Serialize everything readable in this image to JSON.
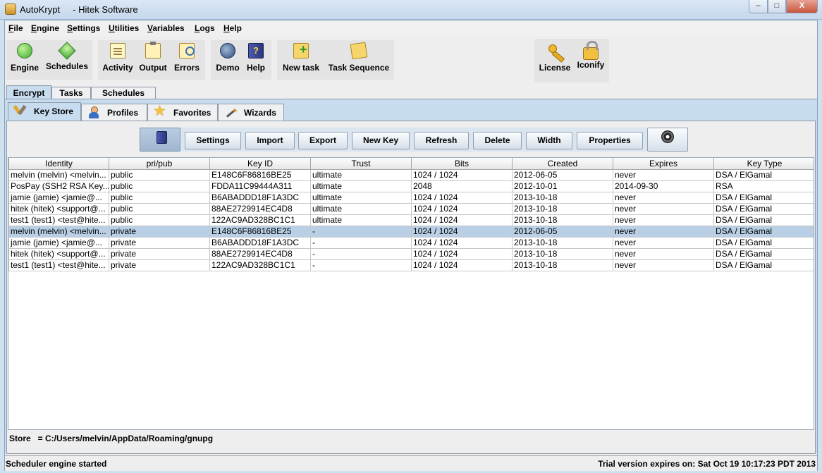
{
  "window": {
    "title": "AutoKrypt",
    "subtitle": "- Hitek Software",
    "minimize_label": "–",
    "maximize_label": "□",
    "close_label": "X"
  },
  "menu": [
    {
      "label": "File",
      "ul": "F",
      "rest": "ile"
    },
    {
      "label": "Engine",
      "ul": "E",
      "rest": "ngine"
    },
    {
      "label": "Settings",
      "ul": "S",
      "rest": "ettings"
    },
    {
      "label": "Utilities",
      "ul": "U",
      "rest": "tilities"
    },
    {
      "label": "Variables",
      "ul": "V",
      "rest": "ariables"
    },
    {
      "label": "Logs",
      "ul": "L",
      "rest": "ogs"
    },
    {
      "label": "Help",
      "ul": "H",
      "rest": "elp"
    }
  ],
  "toolbar": {
    "engine": "Engine",
    "schedules": "Schedules",
    "activity": "Activity",
    "output": "Output",
    "errors": "Errors",
    "demo": "Demo",
    "help": "Help",
    "new_task": "New task",
    "task_sequence": "Task Sequence",
    "license": "License",
    "iconify": "Iconify"
  },
  "main_tabs": [
    "Encrypt",
    "Tasks",
    "Schedules"
  ],
  "sub_tabs": [
    "Key Store",
    "Profiles",
    "Favorites",
    "Wizards"
  ],
  "actions": {
    "settings": "Settings",
    "import": "Import",
    "export": "Export",
    "new_key": "New Key",
    "refresh": "Refresh",
    "delete": "Delete",
    "width": "Width",
    "properties": "Properties"
  },
  "table": {
    "columns": [
      "Identity",
      "pri/pub",
      "Key ID",
      "Trust",
      "Bits",
      "Created",
      "Expires",
      "Key Type"
    ],
    "rows": [
      [
        "melvin (melvin) <melvin...",
        "public",
        "E148C6F86816BE25",
        "ultimate",
        "1024 / 1024",
        "2012-06-05",
        "never",
        "DSA / ElGamal"
      ],
      [
        "PosPay (SSH2 RSA Key...",
        "public",
        "FDDA11C99444A311",
        "ultimate",
        "2048",
        "2012-10-01",
        "2014-09-30",
        "RSA"
      ],
      [
        "jamie (jamie) <jamie@...",
        "public",
        "B6ABADDD18F1A3DC",
        "ultimate",
        "1024 / 1024",
        "2013-10-18",
        "never",
        "DSA / ElGamal"
      ],
      [
        "hitek (hitek) <support@...",
        "public",
        "88AE2729914EC4D8",
        "ultimate",
        "1024 / 1024",
        "2013-10-18",
        "never",
        "DSA / ElGamal"
      ],
      [
        "test1 (test1) <test@hite...",
        "public",
        "122AC9AD328BC1C1",
        "ultimate",
        "1024 / 1024",
        "2013-10-18",
        "never",
        "DSA / ElGamal"
      ],
      [
        "melvin (melvin) <melvin...",
        "private",
        "E148C6F86816BE25",
        "-",
        "1024 / 1024",
        "2012-06-05",
        "never",
        "DSA / ElGamal"
      ],
      [
        "jamie (jamie) <jamie@...",
        "private",
        "B6ABADDD18F1A3DC",
        "-",
        "1024 / 1024",
        "2013-10-18",
        "never",
        "DSA / ElGamal"
      ],
      [
        "hitek (hitek) <support@...",
        "private",
        "88AE2729914EC4D8",
        "-",
        "1024 / 1024",
        "2013-10-18",
        "never",
        "DSA / ElGamal"
      ],
      [
        "test1 (test1) <test@hite...",
        "private",
        "122AC9AD328BC1C1",
        "-",
        "1024 / 1024",
        "2013-10-18",
        "never",
        "DSA / ElGamal"
      ]
    ],
    "selected_row": 5
  },
  "store_path": "Store   = C:/Users/melvin/AppData/Roaming/gnupg",
  "status": {
    "left": "Scheduler engine started",
    "right": "Trial version expires on: Sat Oct 19 10:17:23 PDT 2013"
  }
}
